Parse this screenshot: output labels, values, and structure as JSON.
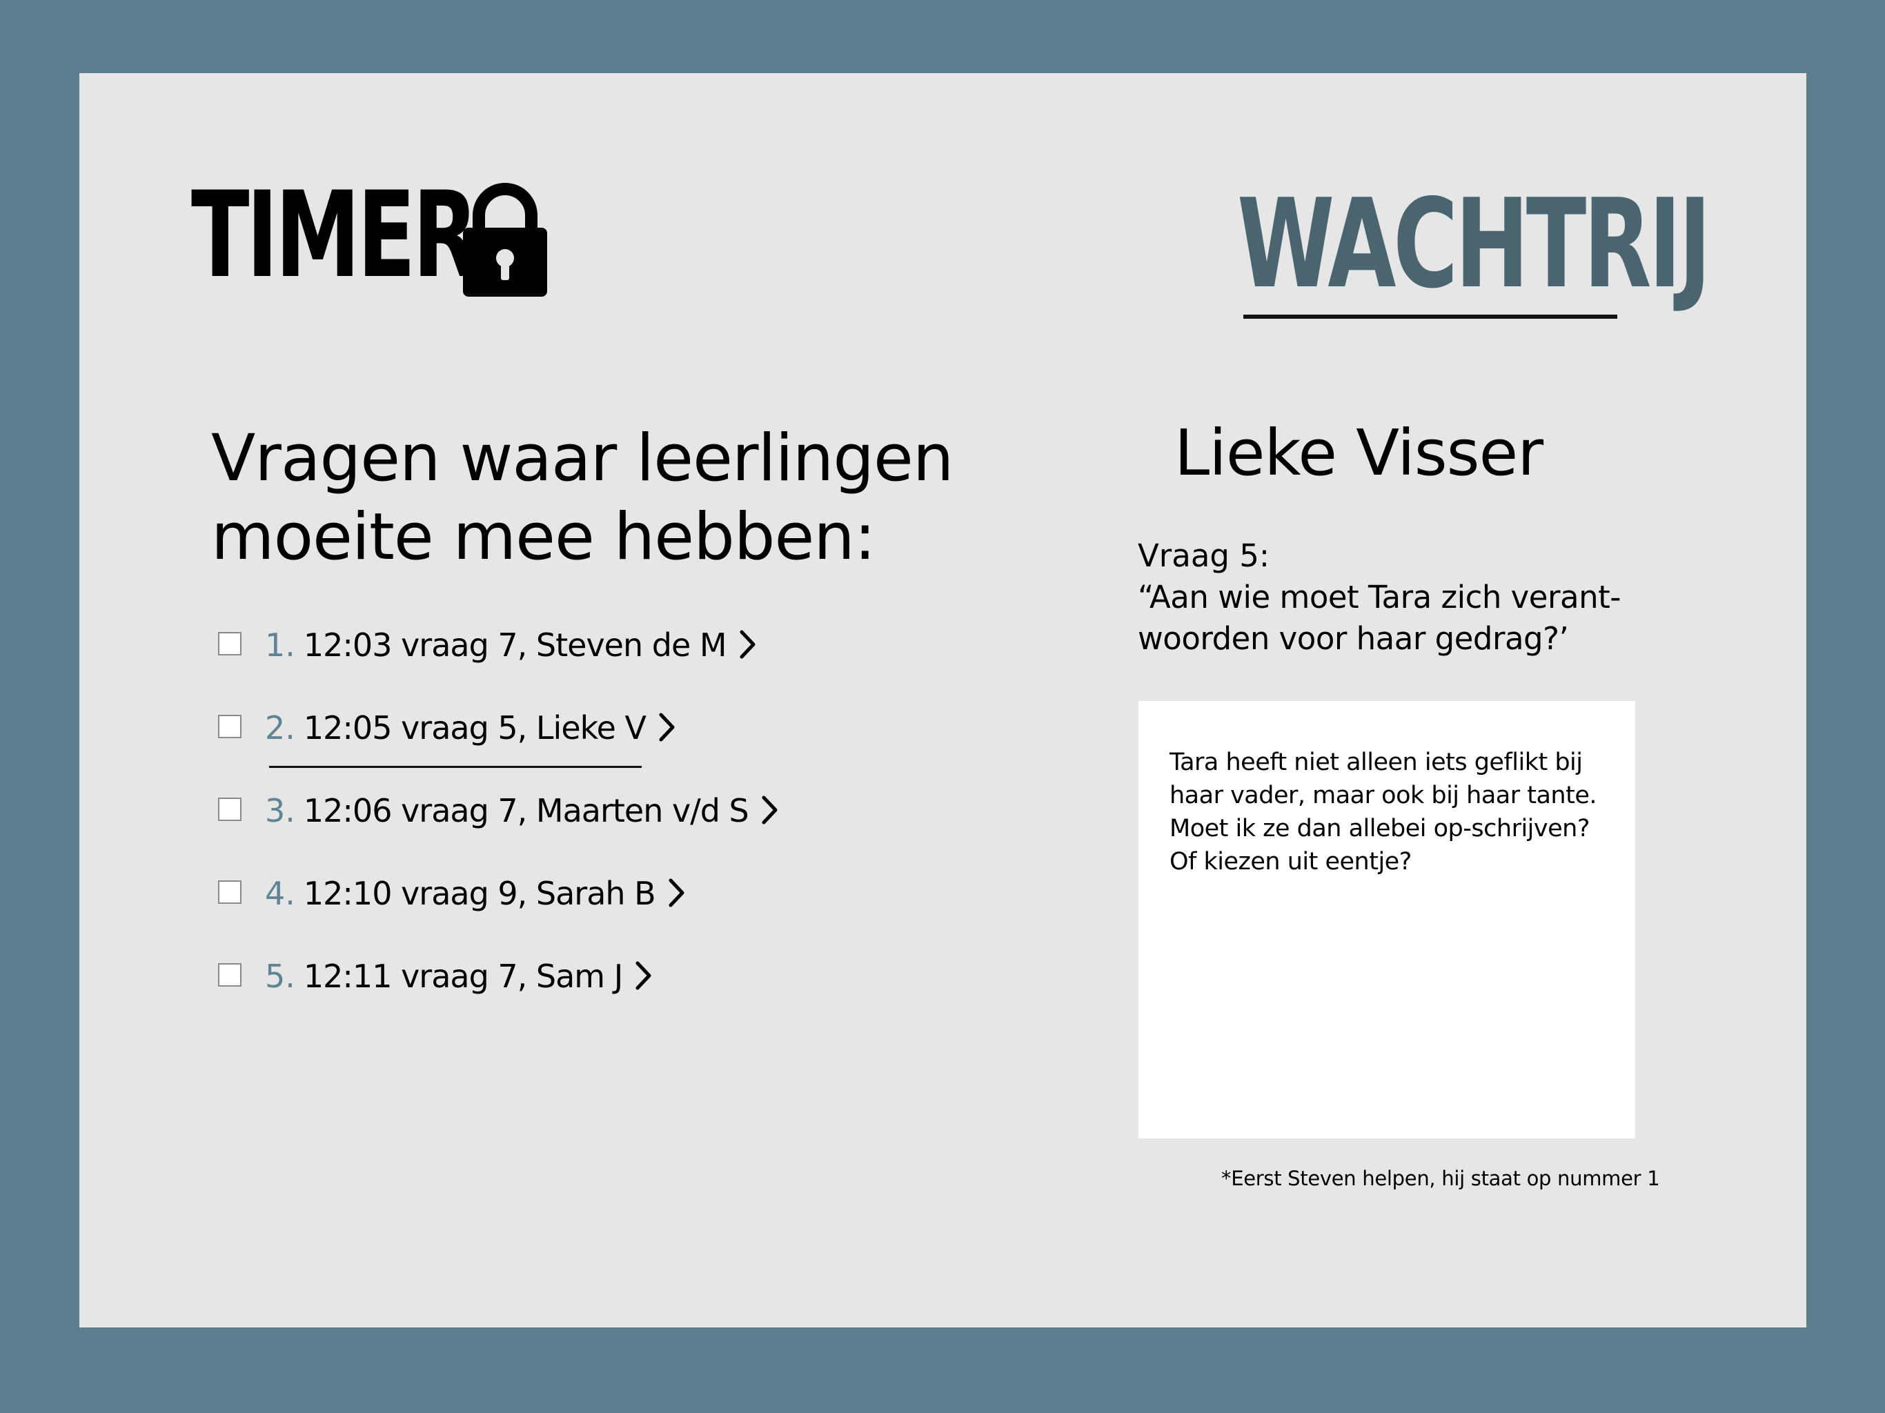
{
  "header": {
    "timer_label": "TIMER",
    "queue_tab_label": "WACHTRIJ"
  },
  "questions": {
    "heading": "Vragen waar leerlingen moeite mee hebben:",
    "items": [
      {
        "number": "1.",
        "text": "12:03  vraag 7, Steven de M"
      },
      {
        "number": "2.",
        "text": "12:05 vraag 5, Lieke V"
      },
      {
        "number": "3.",
        "text": "12:06 vraag 7, Maarten v/d S"
      },
      {
        "number": "4.",
        "text": "12:10 vraag 9, Sarah B"
      },
      {
        "number": "5.",
        "text": "12:11 vraag 7, Sam J"
      }
    ]
  },
  "detail": {
    "student_name": "Lieke Visser",
    "question_label": "Vraag 5:",
    "question_text": "“Aan wie moet Tara zich verant-woorden voor haar gedrag?’",
    "message": "Tara heeft niet alleen iets geflikt bij haar vader, maar ook bij haar tante. Moet ik ze dan allebei op-schrijven? Of kiezen uit eentje?",
    "footnote": "*Eerst Steven helpen, hij staat op nummer 1"
  },
  "colors": {
    "frame": "#5c7f8f",
    "panel": "#e6e6e6",
    "accent": "#4a6470",
    "number": "#5f8494"
  },
  "icons": {
    "lock": "lock-icon",
    "chevron": "chevron-right-icon"
  },
  "state": {
    "selected_item": 2
  }
}
